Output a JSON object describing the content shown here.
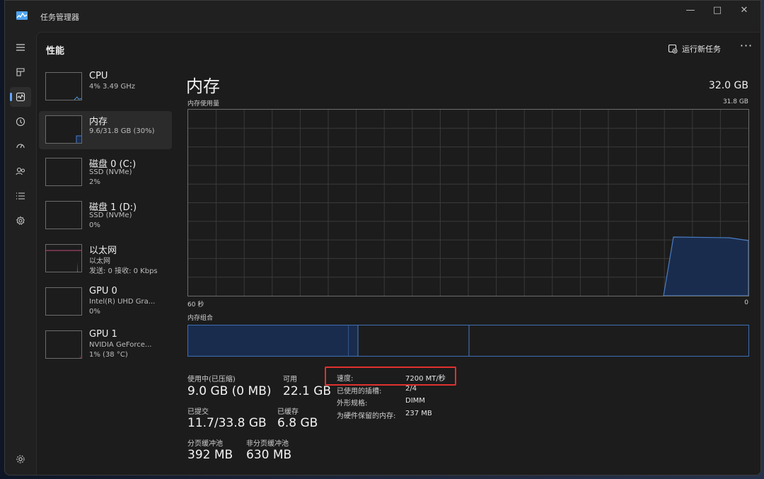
{
  "window": {
    "title": "任务管理器",
    "controls": [
      "minimize-icon",
      "maximize-icon",
      "close-icon"
    ]
  },
  "rail": [
    "hamburger-icon",
    "processes-icon",
    "performance-icon",
    "app-history-icon",
    "startup-icon",
    "users-icon",
    "details-icon",
    "services-icon",
    "settings-icon"
  ],
  "header": {
    "title": "性能",
    "run_task": "运行新任务",
    "more": "···"
  },
  "devices": [
    {
      "name": "CPU",
      "line1": "4% 3.49 GHz",
      "line2": "",
      "line3": ""
    },
    {
      "name": "内存",
      "line1": "9.6/31.8 GB (30%)",
      "line2": "",
      "line3": ""
    },
    {
      "name": "磁盘 0 (C:)",
      "line1": "SSD (NVMe)",
      "line2": "2%",
      "line3": ""
    },
    {
      "name": "磁盘 1 (D:)",
      "line1": "SSD (NVMe)",
      "line2": "0%",
      "line3": ""
    },
    {
      "name": "以太网",
      "line1": "以太网",
      "line2": "发送: 0 接收: 0 Kbps",
      "line3": ""
    },
    {
      "name": "GPU 0",
      "line1": "Intel(R) UHD Gra...",
      "line2": "0%",
      "line3": ""
    },
    {
      "name": "GPU 1",
      "line1": "NVIDIA GeForce...",
      "line2": "1% (38 °C)",
      "line3": ""
    }
  ],
  "memory": {
    "title": "内存",
    "total": "32.0 GB",
    "usage_label": "内存使用量",
    "usage_max": "31.8 GB",
    "axis_left": "60 秒",
    "axis_right": "0",
    "composition_label": "内存组合",
    "stats": {
      "in_use_label": "使用中(已压缩)",
      "in_use_value": "9.0 GB (0 MB)",
      "available_label": "可用",
      "available_value": "22.1 GB",
      "committed_label": "已提交",
      "committed_value": "11.7/33.8 GB",
      "cached_label": "已缓存",
      "cached_value": "6.8 GB",
      "paged_label": "分页缓冲池",
      "paged_value": "392 MB",
      "nonpaged_label": "非分页缓冲池",
      "nonpaged_value": "630 MB"
    },
    "details": [
      {
        "key": "速度:",
        "value": "7200 MT/秒"
      },
      {
        "key": "已使用的插槽:",
        "value": "2/4"
      },
      {
        "key": "外形规格:",
        "value": "DIMM"
      },
      {
        "key": "为硬件保留的内存:",
        "value": "237 MB"
      }
    ]
  },
  "colors": {
    "accent": "#60a8ff",
    "memory_fill": "#1a2c4d",
    "memory_line": "#4a7cc4",
    "highlight": "#e0312f"
  }
}
